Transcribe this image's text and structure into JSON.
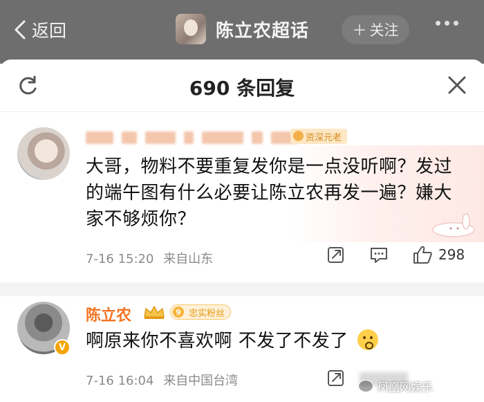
{
  "topbar": {
    "back_label": "返回",
    "title": "陈立农超话",
    "follow_label": "关注",
    "follow_icon": "plus-icon",
    "more_icon": "more-dots-icon",
    "background_color": "#6e6e6e"
  },
  "sheet": {
    "title": "690 条回复",
    "refresh_icon": "refresh-icon",
    "close_icon": "close-icon"
  },
  "comments": [
    {
      "tag": "资深元老",
      "text": "大哥，物料不要重复发你是一点没听啊？发过的端午图有什么必要让陈立农再发一遍？嫌大家不够烦你？",
      "time": "7-16 15:20",
      "location": "来自山东",
      "likes": "298"
    },
    {
      "name": "陈立农",
      "verified_badge": "V",
      "fan_level": "9",
      "fan_tag": "忠实粉丝",
      "text": "啊原来你不喜欢啊 不发了不发了",
      "time": "7-16 16:04",
      "location": "来自中国台湾"
    }
  ],
  "watermark": {
    "text": "凤凰网娱乐"
  },
  "colors": {
    "accent_name": "#f4711f",
    "meta_gray": "#8a8a8a",
    "tag_orange": "#d38a1c"
  }
}
